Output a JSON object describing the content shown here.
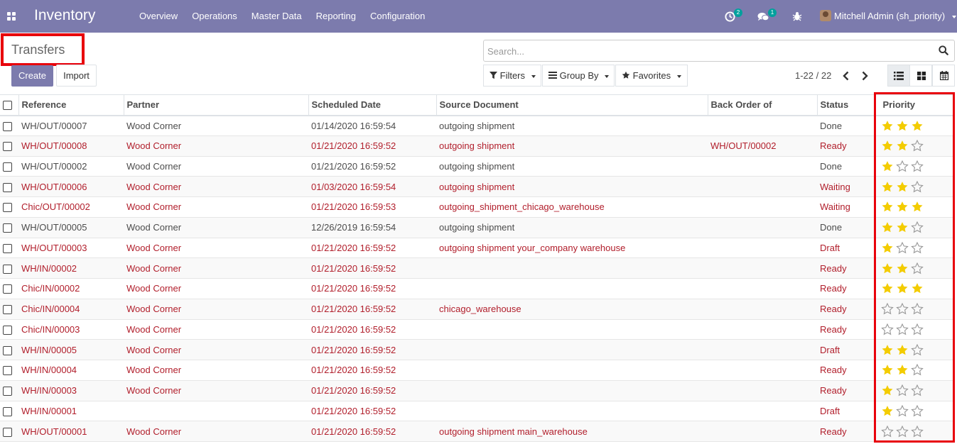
{
  "navbar": {
    "app_title": "Inventory",
    "menu": [
      "Overview",
      "Operations",
      "Master Data",
      "Reporting",
      "Configuration"
    ],
    "activity_count": "2",
    "message_count": "1",
    "user_name": "Mitchell Admin (sh_priority)"
  },
  "control_panel": {
    "title": "Transfers",
    "create_label": "Create",
    "import_label": "Import",
    "search_placeholder": "Search...",
    "filters_label": "Filters",
    "group_by_label": "Group By",
    "favorites_label": "Favorites",
    "pager": "1-22 / 22"
  },
  "table": {
    "columns": [
      "Reference",
      "Partner",
      "Scheduled Date",
      "Source Document",
      "Back Order of",
      "Status",
      "Priority"
    ],
    "rows": [
      {
        "reference": "WH/OUT/00007",
        "partner": "Wood Corner",
        "date": "01/14/2020 16:59:54",
        "source": "outgoing shipment",
        "backorder": "",
        "status": "Done",
        "priority": 3,
        "late": false
      },
      {
        "reference": "WH/OUT/00008",
        "partner": "Wood Corner",
        "date": "01/21/2020 16:59:52",
        "source": "outgoing shipment",
        "backorder": "WH/OUT/00002",
        "status": "Ready",
        "priority": 2,
        "late": true
      },
      {
        "reference": "WH/OUT/00002",
        "partner": "Wood Corner",
        "date": "01/21/2020 16:59:52",
        "source": "outgoing shipment",
        "backorder": "",
        "status": "Done",
        "priority": 1,
        "late": false
      },
      {
        "reference": "WH/OUT/00006",
        "partner": "Wood Corner",
        "date": "01/03/2020 16:59:54",
        "source": "outgoing shipment",
        "backorder": "",
        "status": "Waiting",
        "priority": 2,
        "late": true
      },
      {
        "reference": "Chic/OUT/00002",
        "partner": "Wood Corner",
        "date": "01/21/2020 16:59:53",
        "source": "outgoing_shipment_chicago_warehouse",
        "backorder": "",
        "status": "Waiting",
        "priority": 3,
        "late": true
      },
      {
        "reference": "WH/OUT/00005",
        "partner": "Wood Corner",
        "date": "12/26/2019 16:59:54",
        "source": "outgoing shipment",
        "backorder": "",
        "status": "Done",
        "priority": 2,
        "late": false
      },
      {
        "reference": "WH/OUT/00003",
        "partner": "Wood Corner",
        "date": "01/21/2020 16:59:52",
        "source": "outgoing shipment your_company warehouse",
        "backorder": "",
        "status": "Draft",
        "priority": 1,
        "late": true
      },
      {
        "reference": "WH/IN/00002",
        "partner": "Wood Corner",
        "date": "01/21/2020 16:59:52",
        "source": "",
        "backorder": "",
        "status": "Ready",
        "priority": 2,
        "late": true
      },
      {
        "reference": "Chic/IN/00002",
        "partner": "Wood Corner",
        "date": "01/21/2020 16:59:52",
        "source": "",
        "backorder": "",
        "status": "Ready",
        "priority": 3,
        "late": true
      },
      {
        "reference": "Chic/IN/00004",
        "partner": "Wood Corner",
        "date": "01/21/2020 16:59:52",
        "source": "chicago_warehouse",
        "backorder": "",
        "status": "Ready",
        "priority": 0,
        "late": true
      },
      {
        "reference": "Chic/IN/00003",
        "partner": "Wood Corner",
        "date": "01/21/2020 16:59:52",
        "source": "",
        "backorder": "",
        "status": "Ready",
        "priority": 0,
        "late": true
      },
      {
        "reference": "WH/IN/00005",
        "partner": "Wood Corner",
        "date": "01/21/2020 16:59:52",
        "source": "",
        "backorder": "",
        "status": "Draft",
        "priority": 2,
        "late": true
      },
      {
        "reference": "WH/IN/00004",
        "partner": "Wood Corner",
        "date": "01/21/2020 16:59:52",
        "source": "",
        "backorder": "",
        "status": "Ready",
        "priority": 2,
        "late": true
      },
      {
        "reference": "WH/IN/00003",
        "partner": "Wood Corner",
        "date": "01/21/2020 16:59:52",
        "source": "",
        "backorder": "",
        "status": "Ready",
        "priority": 1,
        "late": true
      },
      {
        "reference": "WH/IN/00001",
        "partner": "",
        "date": "01/21/2020 16:59:52",
        "source": "",
        "backorder": "",
        "status": "Draft",
        "priority": 1,
        "late": true
      },
      {
        "reference": "WH/OUT/00001",
        "partner": "Wood Corner",
        "date": "01/21/2020 16:59:52",
        "source": "outgoing shipment main_warehouse",
        "backorder": "",
        "status": "Ready",
        "priority": 0,
        "late": true
      }
    ]
  },
  "colors": {
    "brand": "#7c7bad",
    "late_text": "#b11e2b",
    "star_filled": "#f3cc00",
    "highlight": "#e8000b"
  }
}
